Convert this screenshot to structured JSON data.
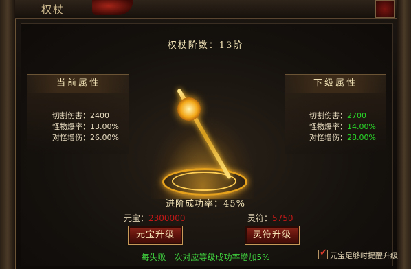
{
  "window": {
    "title": "权杖"
  },
  "stage": {
    "title": "权杖阶数：13阶"
  },
  "current": {
    "heading": "当前属性",
    "rows": [
      {
        "label": "切割伤害：",
        "value": "2400"
      },
      {
        "label": "怪物爆率：",
        "value": "13.00%"
      },
      {
        "label": "对怪增伤：",
        "value": "26.00%"
      }
    ]
  },
  "next": {
    "heading": "下级属性",
    "rows": [
      {
        "label": "切割伤害：",
        "value": "2700"
      },
      {
        "label": "怪物爆率：",
        "value": "14.00%"
      },
      {
        "label": "对怪增伤：",
        "value": "28.00%"
      }
    ]
  },
  "success_rate": "进阶成功率：45%",
  "costs": {
    "ingot_label": "元宝：",
    "ingot_value": "2300000",
    "talisman_label": "灵符：",
    "talisman_value": "5750"
  },
  "buttons": {
    "ingot_upgrade": "元宝升级",
    "talisman_upgrade": "灵符升级"
  },
  "hint": "每失败一次对应等级成功率增加5%",
  "auto_remind": {
    "label": "元宝足够时提醒升级",
    "checked": true
  },
  "colors": {
    "accent_green": "#29d829",
    "cost_red": "#c01818",
    "gold": "#f0e2b6"
  },
  "icons": {
    "item": "scepter-icon",
    "close": "close-icon"
  }
}
